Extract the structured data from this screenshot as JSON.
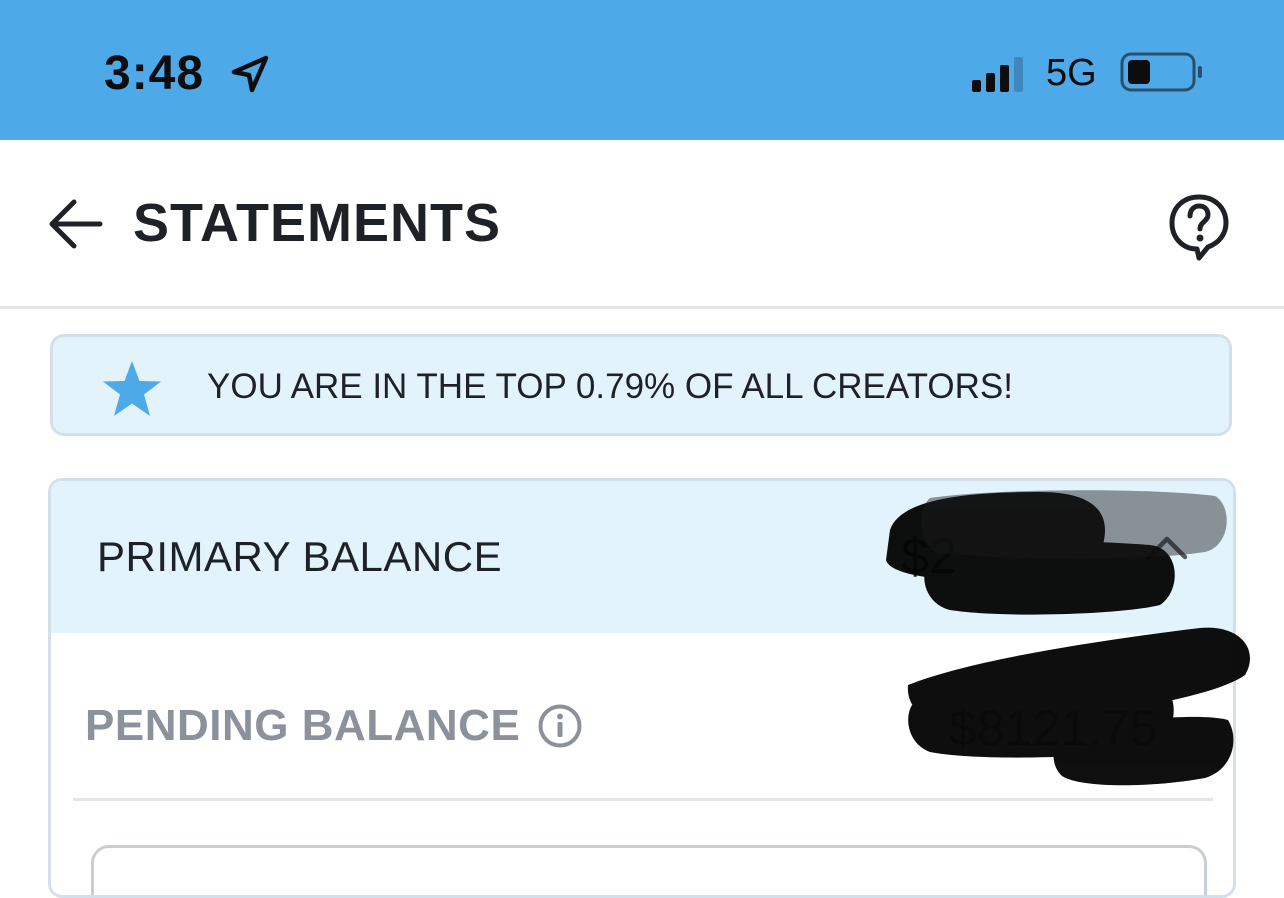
{
  "status_bar": {
    "time": "3:48",
    "network": "5G",
    "icons": [
      "location-arrow-icon",
      "signal-icon",
      "battery-icon"
    ],
    "background_color": "#4ea9e8"
  },
  "header": {
    "title": "STATEMENTS",
    "back_icon": "arrow-left-icon",
    "help_icon": "question-bubble-icon"
  },
  "rank_banner": {
    "text": "YOU ARE IN THE TOP 0.79% OF ALL CREATORS!",
    "icon": "star-icon",
    "star_color": "#4ea9e8",
    "background_color": "#e2f3fc"
  },
  "balances": {
    "primary": {
      "label": "PRIMARY BALANCE",
      "amount": "$2",
      "icon": "chevron-up-icon"
    },
    "pending": {
      "label": "PENDING BALANCE",
      "amount": "$8121.75",
      "icon": "info-icon"
    }
  }
}
